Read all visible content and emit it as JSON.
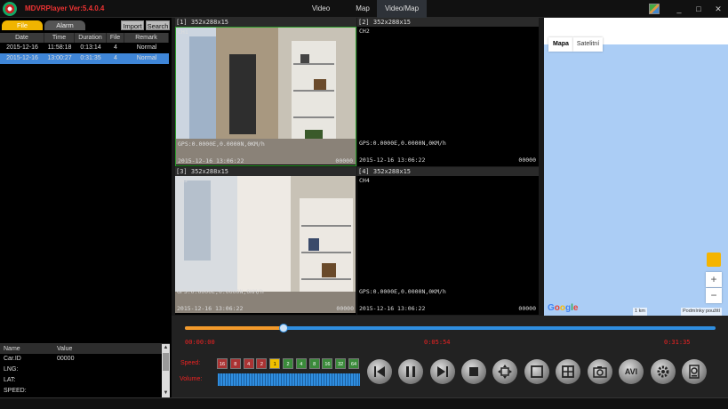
{
  "app": {
    "title": "MDVRPlayer Ver:5.4.0.4",
    "menu": [
      "Video",
      "Map",
      "Video/Map"
    ],
    "active_menu": "Video/Map",
    "window_buttons": [
      "_",
      "□",
      "✕"
    ]
  },
  "file_panel": {
    "tabs": [
      "File",
      "Alarm"
    ],
    "active_tab": "File",
    "import_label": "Import",
    "search_label": "Search",
    "columns": [
      "Date",
      "Time",
      "Duration",
      "File",
      "Remark"
    ],
    "rows": [
      {
        "date": "2015-12-16",
        "time": "11:58:18",
        "duration": "0:13:14",
        "file": "4",
        "remark": "Normal"
      },
      {
        "date": "2015-12-16",
        "time": "13:00:27",
        "duration": "0:31:35",
        "file": "4",
        "remark": "Normal"
      }
    ],
    "selected_row": 1
  },
  "info_panel": {
    "columns": [
      "Name",
      "Value"
    ],
    "rows": [
      {
        "name": "Car.ID",
        "value": "00000"
      },
      {
        "name": "LNG:",
        "value": ""
      },
      {
        "name": "LAT:",
        "value": ""
      },
      {
        "name": "SPEED:",
        "value": ""
      }
    ]
  },
  "videos": [
    {
      "header": "[1] 352x288x15",
      "ch": "CH1",
      "gps": "GPS:0.0000E,0.0000N,0KM/h",
      "datetime": "2015-12-16 13:06:22",
      "frame": "00000",
      "has_video": true
    },
    {
      "header": "[2] 352x288x15",
      "ch": "CH2",
      "gps": "GPS:0.0000E,0.0000N,0KM/h",
      "datetime": "2015-12-16 13:06:22",
      "frame": "00000",
      "has_video": false
    },
    {
      "header": "[3] 352x288x15",
      "ch": "CH3",
      "gps": "GPS:0.0000E,0.0000N,0KM/h",
      "datetime": "2015-12-16 13:06:22",
      "frame": "00000",
      "has_video": true
    },
    {
      "header": "[4] 352x288x15",
      "ch": "CH4",
      "gps": "GPS:0.0000E,0.0000N,0KM/h",
      "datetime": "2015-12-16 13:06:22",
      "frame": "00000",
      "has_video": false
    }
  ],
  "map": {
    "types": [
      "Mapa",
      "Satelitní"
    ],
    "active_type": "Mapa",
    "zoom_in": "+",
    "zoom_out": "−",
    "brand": "Google",
    "scale": "1 km",
    "terms": "Podmínky použití"
  },
  "playback": {
    "start_time": "00:00:00",
    "mid_time": "0:05:54",
    "end_time": "0:31:35",
    "progress_fraction": 0.187,
    "speed_label": "Speed:",
    "volume_label": "Volume:",
    "speeds": [
      "16",
      "8",
      "4",
      "2",
      "1",
      "2",
      "4",
      "8",
      "16",
      "32",
      "64"
    ],
    "active_speed_index": 4,
    "controls": [
      "prev-icon",
      "pause-icon",
      "next-icon",
      "stop-icon",
      "fullscreen-icon",
      "single-view-icon",
      "quad-view-icon",
      "snapshot-icon",
      "avi-icon",
      "settings-icon",
      "record-icon"
    ],
    "avi_label": "AVI"
  },
  "colors": {
    "accent_blue": "#2f8ee0",
    "progress_orange": "#f39a2b",
    "time_red": "#e22",
    "tab_yellow": "#f0b400",
    "selection": "#3f86d8"
  }
}
